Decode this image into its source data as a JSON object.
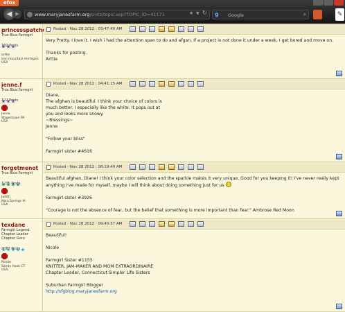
{
  "browser": {
    "menu_label": "efox",
    "url_domain": "www.maryjanesfarm.org",
    "url_path": "/snitz/topic.asp?TOPIC_ID=41171",
    "search_placeholder": "Google",
    "icons": {
      "back": "back-arrow-icon",
      "forward": "forward-arrow-icon",
      "bookmark": "star-icon",
      "reload": "reload-icon",
      "search_engine": "google-icon"
    }
  },
  "forum": {
    "colors": {
      "background": "#fbf7dc",
      "header": "#efe9c7",
      "username": "#8a1a1a",
      "link": "#0a5a9c",
      "badge": "#b51010"
    },
    "posts": [
      {
        "username": "princesspatches",
        "rank": "True Blue Farmgirl",
        "stars": 3,
        "star_color": "#5a49a8",
        "post_count": "182 Posts",
        "badge": false,
        "location": [
          "arttie",
          "iron mountain michigan",
          "USA"
        ],
        "posted": "Posted - Nov 28 2012 :  03:47:40 AM",
        "body": [
          "Very Pretty. I love it. I wish i had the attention span to do and afgan. If a project is not done it under a week, I get bored and move on.",
          "",
          "Thanks for posting.",
          "Arttie"
        ]
      },
      {
        "username": "jenne.f",
        "rank": "True Blue Farmgirl",
        "stars": 3,
        "star_color": "#5a49a8",
        "post_count": "122 Posts",
        "badge": true,
        "location": [
          "Jenne",
          "Wagontown PA",
          "USA"
        ],
        "posted": "Posted - Nov 28 2012 :  04:41:15 AM",
        "body": [
          "Diane,",
          "The afghan is beautiful. I think your choice of colors is",
          "much better. I especially like the white. It pops out at",
          "you and looks more snowy.",
          "~Blessings~",
          "Jenne",
          "",
          "\"Follow your bliss\"",
          "",
          "Farmgirl sister #4616"
        ]
      },
      {
        "username": "forgetmenot",
        "rank": "True Blue Farmgirl",
        "stars": 4,
        "star_color": "#1d8a82",
        "post_count": "1235 Posts",
        "badge": true,
        "location": [
          "Judith",
          "Nora Springs IA",
          "USA"
        ],
        "posted": "Posted - Nov 28 2012 :  08:19:49 AM",
        "body": [
          "Beautiful afghan, Diane! I think your color selection and the sparkle makes it very unique. Good for you keeping it! I've never really kept anything I've made for myself..maybe I will think about doing something just for us",
          "",
          "Farmgirl sister #3926",
          "",
          "\"Courage is not the absence of fear, but the belief that something is more important than fear.\" Ambrose Red Moon"
        ]
      },
      {
        "username": "texdane",
        "rank_lines": [
          "Farmgirl Legend",
          "Chapter Leader",
          "Chapter Guru"
        ],
        "stars": 5,
        "star_color": "#2aa9d6",
        "post_count": "2083 Posts",
        "badge": true,
        "location": [
          "Nicole",
          "Sandy Hook CT",
          "USA"
        ],
        "posted": "Posted - Nov 28 2012 :  09:40:37 AM",
        "body": [
          "Beautiful!",
          "",
          "Nicole",
          "",
          "Farmgirl Sister #1155",
          "KNITTER, JAM-MAKER AND MOM EXTRAORDINAIRE",
          "Chapter Leader, Connecticut Simpler Life Sisters",
          "",
          "Suburban Farmgirl Blogger"
        ],
        "link": "http://sfgblog.maryjanesfarm.org"
      }
    ]
  }
}
